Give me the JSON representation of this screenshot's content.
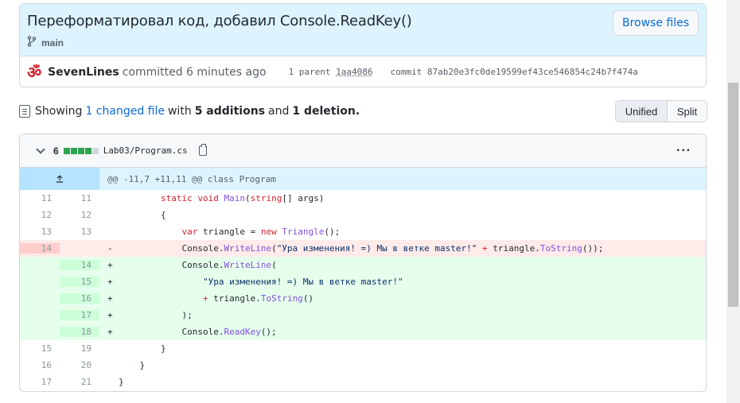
{
  "commit": {
    "title": "Переформатировал код, добавил Console.ReadKey()",
    "branch": "main",
    "browse_label": "Browse files",
    "author": "SevenLines",
    "committed_text": "committed 6 minutes ago",
    "parent_label": "1 parent",
    "parent_sha": "1aa4086",
    "commit_label": "commit",
    "commit_sha": "87ab20e3fc0de19599ef43ce546854c24b7f474a"
  },
  "summary": {
    "showing": "Showing",
    "changed": "1 changed file",
    "with": "with",
    "additions": "5 additions",
    "and": "and",
    "deletions": "1 deletion."
  },
  "view_toggle": {
    "unified": "Unified",
    "split": "Split"
  },
  "file": {
    "change_count": "6",
    "name": "Lab03/Program.cs",
    "hunk_header": "@@ -11,7 +11,11 @@ class Program",
    "lines": [
      {
        "type": "ctx",
        "old": "11",
        "new": "11",
        "sign": " ",
        "code": "        static void Main(string[] args)"
      },
      {
        "type": "ctx",
        "old": "12",
        "new": "12",
        "sign": " ",
        "code": "        {"
      },
      {
        "type": "ctx",
        "old": "13",
        "new": "13",
        "sign": " ",
        "code": "            var triangle = new Triangle();"
      },
      {
        "type": "del",
        "old": "14",
        "new": "",
        "sign": "-",
        "code": "            Console.WriteLine(\"Ура изменения! =) Мы в ветке master!\" + triangle.ToString());"
      },
      {
        "type": "add",
        "old": "",
        "new": "14",
        "sign": "+",
        "code": "            Console.WriteLine("
      },
      {
        "type": "add",
        "old": "",
        "new": "15",
        "sign": "+",
        "code": "                \"Ура изменения! =) Мы в ветке master!\""
      },
      {
        "type": "add",
        "old": "",
        "new": "16",
        "sign": "+",
        "code": "                + triangle.ToString()"
      },
      {
        "type": "add",
        "old": "",
        "new": "17",
        "sign": "+",
        "code": "            );"
      },
      {
        "type": "add",
        "old": "",
        "new": "18",
        "sign": "+",
        "code": "            Console.ReadKey();"
      },
      {
        "type": "ctx",
        "old": "15",
        "new": "19",
        "sign": " ",
        "code": "        }"
      },
      {
        "type": "ctx",
        "old": "16",
        "new": "20",
        "sign": " ",
        "code": "    }"
      },
      {
        "type": "ctx",
        "old": "17",
        "new": "21",
        "sign": " ",
        "code": "}"
      }
    ]
  },
  "colors": {
    "accent": "#0969da",
    "addition": "#2da44e",
    "deletion_bg": "#ffebe9",
    "addition_bg": "#e6ffec",
    "header_bg": "#ddf4ff"
  }
}
